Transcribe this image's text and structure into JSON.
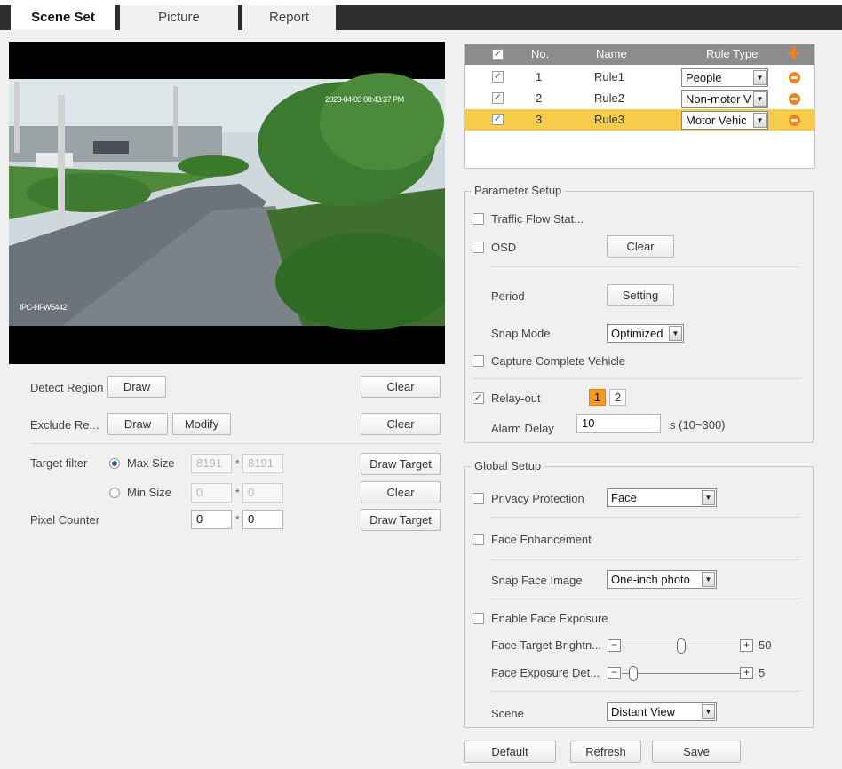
{
  "tabs": [
    {
      "label": "Scene Set",
      "active": true
    },
    {
      "label": "Picture",
      "active": false
    },
    {
      "label": "Report",
      "active": false
    }
  ],
  "video": {
    "timestamp": "2023-04-03 08:43:37 PM",
    "channel_label": "IPC-HFW5442"
  },
  "left": {
    "detect_region": {
      "label": "Detect Region",
      "draw": "Draw",
      "clear": "Clear"
    },
    "exclude_region": {
      "label": "Exclude Re...",
      "draw": "Draw",
      "modify": "Modify",
      "clear": "Clear"
    },
    "target_filter": {
      "label": "Target filter",
      "max_size": {
        "label": "Max Size",
        "w": "8191",
        "h": "8191",
        "selected": true
      },
      "min_size": {
        "label": "Min Size",
        "w": "0",
        "h": "0",
        "selected": false
      },
      "draw_target": "Draw Target",
      "clear": "Clear"
    },
    "pixel_counter": {
      "label": "Pixel Counter",
      "w": "0",
      "h": "0",
      "draw_target": "Draw Target"
    },
    "star": "*"
  },
  "rules": {
    "headers": {
      "no": "No.",
      "name": "Name",
      "rule_type": "Rule Type"
    },
    "rows": [
      {
        "no": "1",
        "name": "Rule1",
        "type": "People",
        "checked": true
      },
      {
        "no": "2",
        "name": "Rule2",
        "type": "Non-motor V",
        "checked": true
      },
      {
        "no": "3",
        "name": "Rule3",
        "type": "Motor Vehic",
        "checked": true
      }
    ]
  },
  "parameter_setup": {
    "legend": "Parameter Setup",
    "traffic_flow": "Traffic Flow Stat...",
    "osd": "OSD",
    "osd_clear": "Clear",
    "period": "Period",
    "period_setting": "Setting",
    "snap_mode": "Snap Mode",
    "snap_mode_value": "Optimized",
    "capture_complete": "Capture Complete Vehicle",
    "relay_out": "Relay-out",
    "relay_1": "1",
    "relay_2": "2",
    "alarm_delay": "Alarm Delay",
    "alarm_delay_value": "10",
    "alarm_delay_unit": "s (10~300)"
  },
  "global_setup": {
    "legend": "Global Setup",
    "privacy_protection": "Privacy Protection",
    "privacy_value": "Face",
    "face_enhancement": "Face Enhancement",
    "snap_face_image": "Snap Face Image",
    "snap_face_value": "One-inch photo",
    "enable_face_exposure": "Enable Face Exposure",
    "face_target_brightness": "Face Target Brightn...",
    "face_target_brightness_value": "50",
    "face_target_brightness_level": 0.5,
    "face_exposure_detect": "Face Exposure Det...",
    "face_exposure_detect_value": "5",
    "face_exposure_detect_level": 0.1,
    "scene": "Scene",
    "scene_value": "Distant View"
  },
  "footer": {
    "default": "Default",
    "refresh": "Refresh",
    "save": "Save"
  },
  "colors": {
    "accent": "#f6cd4a",
    "relay_on": "#f59a1d",
    "delete": "#f58220",
    "header": "#8c8c8c"
  }
}
